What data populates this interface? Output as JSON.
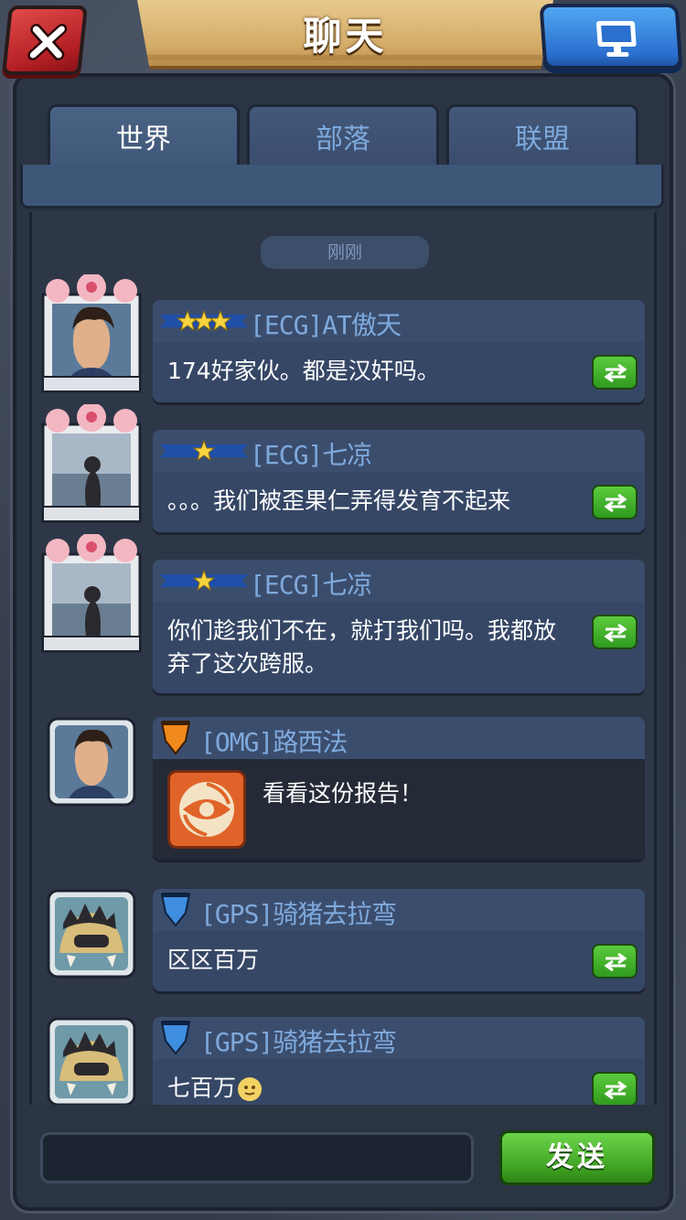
{
  "header": {
    "title": "聊天"
  },
  "tabs": [
    {
      "label": "世界",
      "active": true
    },
    {
      "label": "部落",
      "active": false
    },
    {
      "label": "联盟",
      "active": false
    }
  ],
  "timestamp": "刚刚",
  "messages": [
    {
      "stars": 3,
      "badge": "star-ribbon",
      "sender": "[ECG]AT傲天",
      "text": "174好家伙。都是汉奸吗。",
      "avatar": "warrior-portrait",
      "frame": "sakura-frame"
    },
    {
      "stars": 1,
      "badge": "star-ribbon",
      "sender": "[ECG]七凉",
      "text": "。。。我们被歪果仁弄得发育不起来",
      "avatar": "sea-photo-portrait",
      "frame": "sakura-frame"
    },
    {
      "stars": 1,
      "badge": "star-ribbon",
      "sender": "[ECG]七凉",
      "text": "你们趁我们不在，就打我们吗。我都放弃了这次跨服。",
      "avatar": "sea-photo-portrait",
      "frame": "sakura-frame"
    },
    {
      "badge": "orange-shield",
      "sender": "[OMG]路西法",
      "text": "看看这份报告！",
      "avatar": "warrior-portrait",
      "attachment": "battle-report-icon"
    },
    {
      "badge": "blue-shield",
      "sender": "[GPS]骑猪去拉弯",
      "text": "区区百万",
      "avatar": "beast-portrait"
    },
    {
      "badge": "blue-shield",
      "sender": "[GPS]骑猪去拉弯",
      "text": "七百万",
      "avatar": "beast-portrait",
      "emoji": "smiley-emoji"
    }
  ],
  "composer": {
    "value": "",
    "send_label": "发送"
  },
  "colors": {
    "accent_blue": "#7ea9dc",
    "send_green": "#3fa322",
    "close_red": "#c42a2f",
    "title_gold": "#d4ac68"
  }
}
